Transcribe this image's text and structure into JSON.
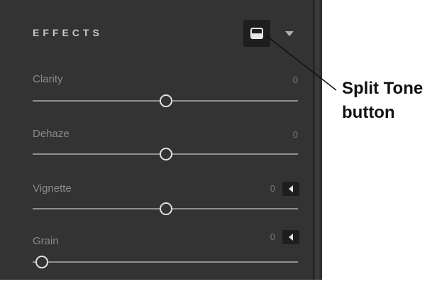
{
  "panel": {
    "title": "EFFECTS",
    "split_tone_icon": "split-tone-icon",
    "menu_icon": "chevron-down-icon"
  },
  "sliders": [
    {
      "label": "Clarity",
      "value": "0",
      "position": 0.5,
      "has_button": false
    },
    {
      "label": "Dehaze",
      "value": "0",
      "position": 0.5,
      "has_button": false
    },
    {
      "label": "Vignette",
      "value": "0",
      "position": 0.5,
      "has_button": true
    },
    {
      "label": "Grain",
      "value": "0",
      "position": 0.0,
      "has_button": true
    }
  ],
  "callout": {
    "line1": "Split Tone",
    "line2": "button"
  }
}
